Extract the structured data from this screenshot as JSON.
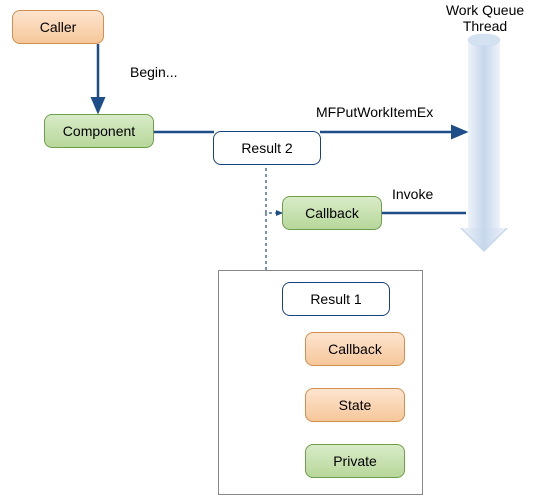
{
  "nodes": {
    "caller": "Caller",
    "component": "Component",
    "result2": "Result 2",
    "callback": "Callback",
    "result1": "Result 1",
    "innerCallback": "Callback",
    "state": "State",
    "private": "Private"
  },
  "edges": {
    "begin": "Begin...",
    "put": "MFPutWorkItemEx",
    "invoke": "Invoke"
  },
  "thread": {
    "line1": "Work Queue",
    "line2": "Thread"
  },
  "colors": {
    "arrow": "#1d4e89",
    "dashed": "#1d4e89",
    "cylinderLight": "#dfe9f4",
    "cylinderMid": "#c6d7ec",
    "cylinderDark": "#9fb9d8"
  }
}
